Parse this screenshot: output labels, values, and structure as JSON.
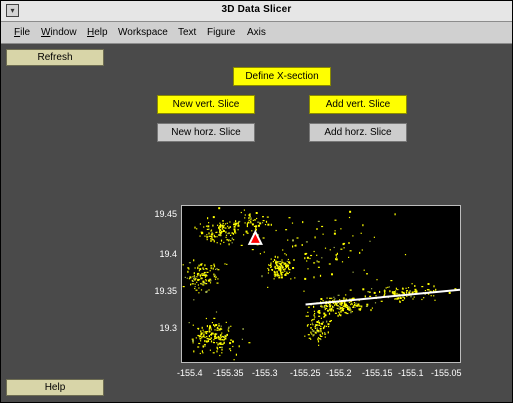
{
  "window": {
    "title": "3D Data Slicer",
    "menu_button_icon": "window-menu-icon"
  },
  "menu": {
    "items": [
      {
        "label": "File",
        "underline": "F",
        "rest": "ile"
      },
      {
        "label": "Window",
        "underline": "W",
        "rest": "indow"
      },
      {
        "label": "Help",
        "underline": "H",
        "rest": "elp"
      },
      {
        "label": "Workspace",
        "underline": "",
        "rest": "Workspace"
      },
      {
        "label": "Text",
        "underline": "",
        "rest": "Text"
      },
      {
        "label": "Figure",
        "underline": "",
        "rest": "Figure"
      },
      {
        "label": "Axis",
        "underline": "",
        "rest": "Axis"
      }
    ]
  },
  "sidebar": {
    "refresh_label": "Refresh",
    "help_label": "Help"
  },
  "controls": {
    "define_xsection": "Define X-section",
    "new_vert_slice": "New vert. Slice",
    "add_vert_slice": "Add vert. Slice",
    "new_horz_slice": "New horz. Slice",
    "add_horz_slice": "Add horz. Slice"
  },
  "plot": {
    "y_ticks": [
      "19.45",
      "19.4",
      "19.35",
      "19.3"
    ],
    "x_ticks": [
      "-155.4",
      "-155.35",
      "-155.3",
      "-155.25",
      "-155.2",
      "-155.15",
      "-155.1",
      "-155.05"
    ],
    "colors": {
      "background": "#000000",
      "points": "#ffff00",
      "line": "#ffffff",
      "marker": "#ffffff",
      "marker_center": "#ff0000"
    }
  },
  "chart_data": {
    "type": "scatter",
    "title": "",
    "xlabel": "",
    "ylabel": "",
    "xlim": [
      -155.41,
      -155.05
    ],
    "ylim": [
      19.27,
      19.46
    ],
    "x_ticks": [
      -155.4,
      -155.35,
      -155.3,
      -155.25,
      -155.2,
      -155.15,
      -155.1,
      -155.05
    ],
    "y_ticks": [
      19.45,
      19.4,
      19.35,
      19.3
    ],
    "grid": false,
    "clusters": [
      {
        "x": -155.36,
        "y": 19.43,
        "spread_x": 0.03,
        "spread_y": 0.015,
        "count": 120
      },
      {
        "x": -155.385,
        "y": 19.375,
        "spread_x": 0.02,
        "spread_y": 0.02,
        "count": 110
      },
      {
        "x": -155.37,
        "y": 19.3,
        "spread_x": 0.03,
        "spread_y": 0.02,
        "count": 160
      },
      {
        "x": -155.285,
        "y": 19.385,
        "spread_x": 0.015,
        "spread_y": 0.012,
        "count": 110
      },
      {
        "x": -155.235,
        "y": 19.315,
        "spread_x": 0.015,
        "spread_y": 0.02,
        "count": 90
      },
      {
        "x": -155.205,
        "y": 19.34,
        "spread_x": 0.03,
        "spread_y": 0.01,
        "count": 150
      },
      {
        "x": -155.13,
        "y": 19.355,
        "spread_x": 0.05,
        "spread_y": 0.01,
        "count": 110
      },
      {
        "x": -155.32,
        "y": 19.44,
        "spread_x": 0.02,
        "spread_y": 0.012,
        "count": 45
      },
      {
        "x": -155.235,
        "y": 19.41,
        "spread_x": 0.08,
        "spread_y": 0.04,
        "count": 90
      }
    ],
    "cross_section": {
      "x": [
        -155.25,
        -155.05
      ],
      "y": [
        19.34,
        19.358
      ]
    },
    "marker": {
      "shape": "triangle",
      "x": -155.315,
      "y": 19.42
    }
  }
}
